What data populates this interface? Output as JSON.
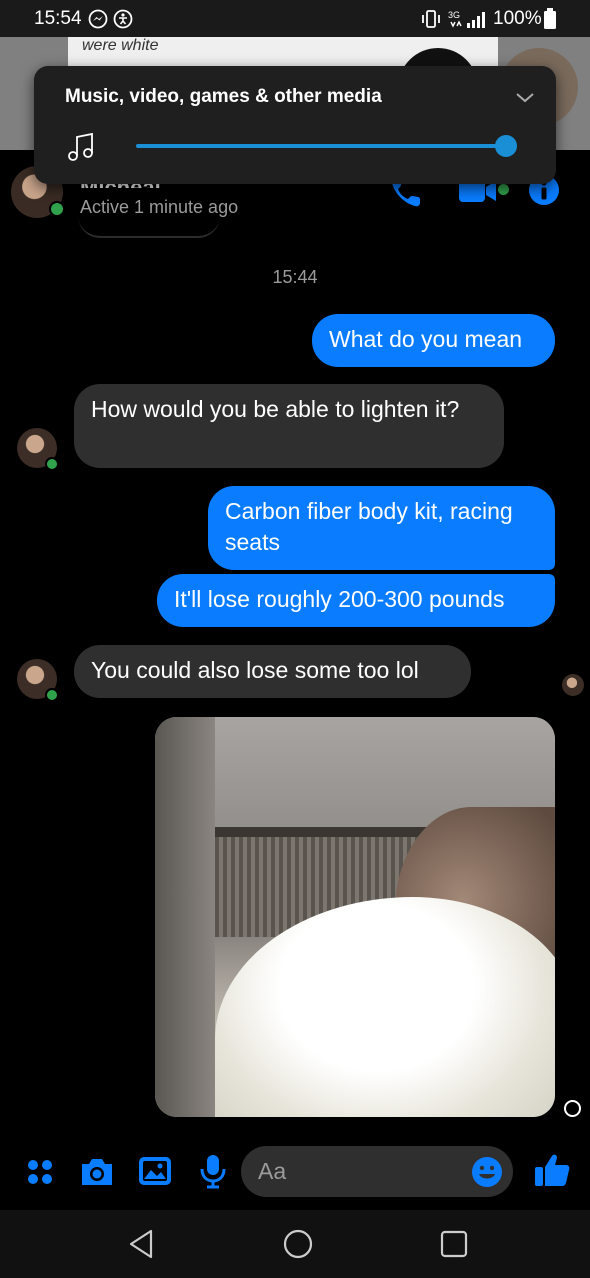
{
  "status_bar": {
    "time": "15:54",
    "battery": "100%",
    "network": "3G"
  },
  "background_app": {
    "peek_text": "were white"
  },
  "volume_panel": {
    "title": "Music, video, games & other media",
    "level": 1.0,
    "icon": "music-note-icon"
  },
  "header": {
    "contact_name": "Micheal",
    "active_status": "Active 1 minute ago",
    "icons": [
      "phone-icon",
      "video-icon",
      "info-icon"
    ]
  },
  "conversation": {
    "timestamp": "15:44",
    "messages": [
      {
        "direction": "outgoing",
        "text": "What do you mean"
      },
      {
        "direction": "incoming",
        "text": "How would you be able to lighten it?"
      },
      {
        "direction": "outgoing",
        "text": "Carbon fiber body kit, racing seats"
      },
      {
        "direction": "outgoing",
        "text": "It'll lose roughly 200-300 pounds"
      },
      {
        "direction": "incoming",
        "text": "You could also lose some too lol"
      },
      {
        "direction": "outgoing",
        "type": "photo"
      }
    ]
  },
  "composer": {
    "placeholder": "Aa",
    "icons": [
      "more-icon",
      "camera-icon",
      "gallery-icon",
      "mic-icon",
      "emoji-icon",
      "like-icon"
    ]
  },
  "colors": {
    "accent": "#0a7cff",
    "incoming_bubble": "#2f2f2f",
    "online": "#31a24c",
    "background": "#000000"
  }
}
